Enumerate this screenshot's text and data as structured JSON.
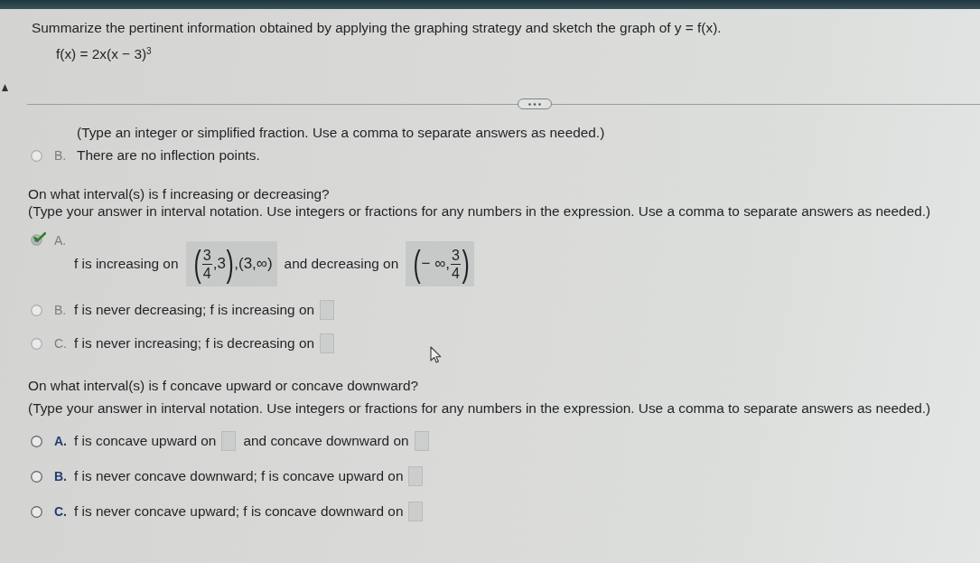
{
  "problem": {
    "instruction": "Summarize the pertinent information obtained by applying the graphing strategy and sketch the graph of y = f(x).",
    "function": "f(x) = 2x(x − 3)$^{3}$"
  },
  "questions": [
    {
      "disabled": true,
      "note": "(Type an integer or simplified fraction. Use a comma to separate answers as needed.)",
      "options": [
        {
          "letter": "B.",
          "selected": false,
          "parts": [
            {
              "kind": "text",
              "text": "There are no inflection points."
            }
          ]
        }
      ]
    },
    {
      "disabled": true,
      "prompt": "On what interval(s) is f increasing or decreasing?",
      "instruction": "(Type your answer in interval notation. Use integers or fractions for any numbers in the expression. Use a comma to separate answers as needed.)",
      "options": [
        {
          "letter": "A.",
          "selected": true,
          "parts": [
            {
              "kind": "text",
              "text": "f is increasing on"
            },
            {
              "kind": "answer",
              "tokens": [
                {
                  "kind": "big",
                  "text": "("
                },
                {
                  "kind": "fraction",
                  "numerator": "3",
                  "denominator": "4"
                },
                {
                  "kind": "text",
                  "text": ",3"
                },
                {
                  "kind": "big",
                  "text": ")"
                },
                {
                  "kind": "text",
                  "text": ",(3,∞)"
                }
              ]
            },
            {
              "kind": "text",
              "text": "and decreasing on"
            },
            {
              "kind": "answer",
              "tokens": [
                {
                  "kind": "big",
                  "text": "("
                },
                {
                  "kind": "text",
                  "text": "− ∞,"
                },
                {
                  "kind": "fraction",
                  "numerator": "3",
                  "denominator": "4"
                },
                {
                  "kind": "big",
                  "text": ")"
                }
              ]
            }
          ]
        },
        {
          "letter": "B.",
          "selected": false,
          "parts": [
            {
              "kind": "text",
              "text": "f is never decreasing; f is increasing on"
            },
            {
              "kind": "blank"
            }
          ]
        },
        {
          "letter": "C.",
          "selected": false,
          "parts": [
            {
              "kind": "text",
              "text": "f is never increasing; f is decreasing on"
            },
            {
              "kind": "blank"
            }
          ]
        }
      ]
    },
    {
      "disabled": false,
      "prompt": "On what interval(s) is f concave upward or concave downward?",
      "instruction": "(Type your answer in interval notation. Use integers or fractions for any numbers in the expression. Use a comma to separate answers as needed.)",
      "options": [
        {
          "letter": "A.",
          "selected": false,
          "parts": [
            {
              "kind": "text",
              "text": "f is concave upward on"
            },
            {
              "kind": "blank"
            },
            {
              "kind": "text",
              "text": "and concave downward on"
            },
            {
              "kind": "blank"
            }
          ]
        },
        {
          "letter": "B.",
          "selected": false,
          "parts": [
            {
              "kind": "text",
              "text": "f is never concave downward; f is concave upward on"
            },
            {
              "kind": "blank"
            }
          ]
        },
        {
          "letter": "C.",
          "selected": false,
          "parts": [
            {
              "kind": "text",
              "text": "f is never concave upward; f is concave downward on"
            },
            {
              "kind": "blank"
            }
          ]
        }
      ]
    }
  ]
}
